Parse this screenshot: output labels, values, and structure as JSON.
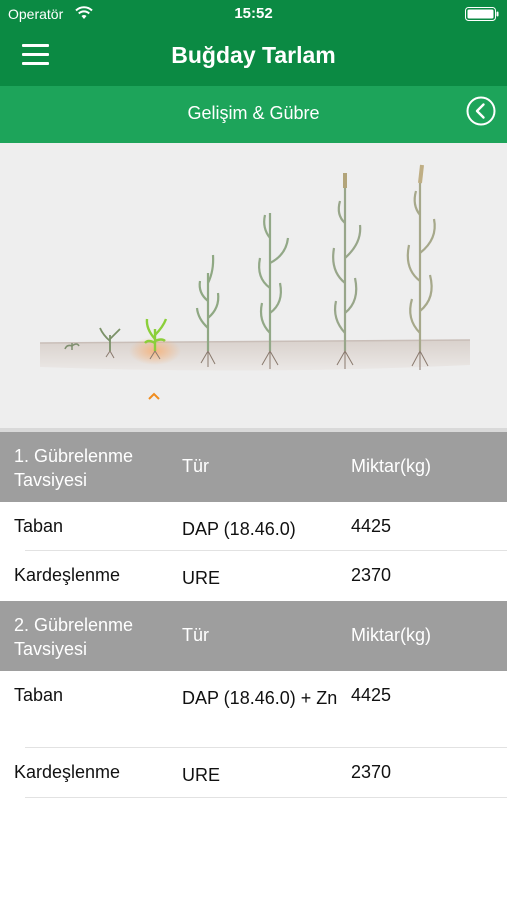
{
  "status_bar": {
    "carrier": "Operatör",
    "time": "15:52"
  },
  "header": {
    "title": "Buğday Tarlam"
  },
  "subheader": {
    "title": "Gelişim & Gübre"
  },
  "tables": [
    {
      "headers": [
        "1. Gübrelenme Tavsiyesi",
        "Tür",
        "Miktar(kg)"
      ],
      "rows": [
        [
          "Taban",
          "DAP (18.46.0)",
          "4425"
        ],
        [
          "Kardeşlenme",
          "URE",
          "2370"
        ]
      ]
    },
    {
      "headers": [
        "2. Gübrelenme Tavsiyesi",
        "Tür",
        "Miktar(kg)"
      ],
      "rows": [
        [
          "Taban",
          "DAP (18.46.0) + Zn",
          "4425"
        ],
        [
          "Kardeşlenme",
          "URE",
          "2370"
        ]
      ]
    }
  ],
  "colors": {
    "header": "#0b8a43",
    "subheader": "#1da45a",
    "table_header": "#9e9e9e",
    "accent": "#f08c1e"
  }
}
